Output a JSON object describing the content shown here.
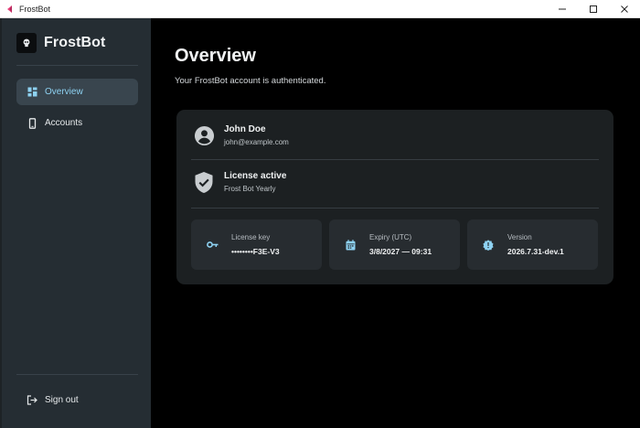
{
  "window": {
    "title": "FrostBot"
  },
  "sidebar": {
    "brand": "FrostBot",
    "items": [
      {
        "label": "Overview",
        "icon": "dashboard-icon",
        "active": true
      },
      {
        "label": "Accounts",
        "icon": "phone-icon",
        "active": false
      }
    ],
    "sign_out": {
      "label": "Sign out",
      "icon": "logout-icon"
    }
  },
  "main": {
    "title": "Overview",
    "subtitle": "Your FrostBot account is authenticated.",
    "user": {
      "name": "John Doe",
      "email": "john@example.com",
      "icon": "account-circle-icon"
    },
    "license": {
      "title": "License active",
      "plan": "Frost Bot Yearly",
      "icon": "shield-check-icon"
    },
    "tiles": [
      {
        "label": "License key",
        "value": "••••••••F3E-V3",
        "icon": "key-icon"
      },
      {
        "label": "Expiry (UTC)",
        "value": "3/8/2027 — 09:31",
        "icon": "calendar-icon"
      },
      {
        "label": "Version",
        "value": "2026.7.31-dev.1",
        "icon": "version-badge-icon"
      }
    ]
  },
  "colors": {
    "accent": "#8ed2f2",
    "sidebar_bg": "#252d33",
    "card_bg": "#1c2022",
    "tile_bg": "#272c30",
    "main_bg": "#000000"
  }
}
